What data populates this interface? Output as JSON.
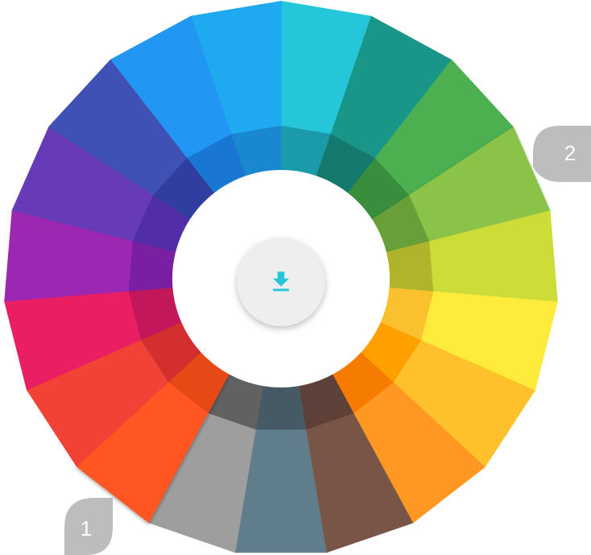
{
  "wheel": {
    "segments": [
      {
        "name": "cyan",
        "outer": "#26C6DA",
        "inner": "#1A9AAA"
      },
      {
        "name": "teal",
        "outer": "#1A9688",
        "inner": "#147A6E"
      },
      {
        "name": "green",
        "outer": "#4CAF50",
        "inner": "#388E3C"
      },
      {
        "name": "light-green",
        "outer": "#8BC34A",
        "inner": "#689F38"
      },
      {
        "name": "lime",
        "outer": "#CDDC39",
        "inner": "#AFB42B"
      },
      {
        "name": "yellow",
        "outer": "#FFEB3B",
        "inner": "#FBC02D"
      },
      {
        "name": "amber",
        "outer": "#FFC12B",
        "inner": "#FFA000"
      },
      {
        "name": "orange",
        "outer": "#FF9822",
        "inner": "#F57C00"
      },
      {
        "name": "brown",
        "outer": "#795548",
        "inner": "#5D4037"
      },
      {
        "name": "blue-grey",
        "outer": "#607D8B",
        "inner": "#455A64"
      },
      {
        "name": "grey",
        "outer": "#9E9E9E",
        "inner": "#616161"
      },
      {
        "name": "deep-orange",
        "outer": "#FF5722",
        "inner": "#E64A19"
      },
      {
        "name": "red",
        "outer": "#F24236",
        "inner": "#D32F2F"
      },
      {
        "name": "pink",
        "outer": "#E91E63",
        "inner": "#C2185B"
      },
      {
        "name": "purple",
        "outer": "#9C27B0",
        "inner": "#7B1FA2"
      },
      {
        "name": "deep-purple",
        "outer": "#673AB7",
        "inner": "#512DA8"
      },
      {
        "name": "indigo",
        "outer": "#3F51B5",
        "inner": "#303F9F"
      },
      {
        "name": "blue",
        "outer": "#2196F3",
        "inner": "#1976D2"
      },
      {
        "name": "light-blue",
        "outer": "#1EA9F0",
        "inner": "#1A88D0"
      }
    ]
  },
  "callouts": [
    {
      "label": "1",
      "color": "#BDBDBD"
    },
    {
      "label": "2",
      "color": "#BDBDBD"
    }
  ],
  "download_button": {
    "icon": "download-icon",
    "icon_color": "#26C6DA"
  }
}
